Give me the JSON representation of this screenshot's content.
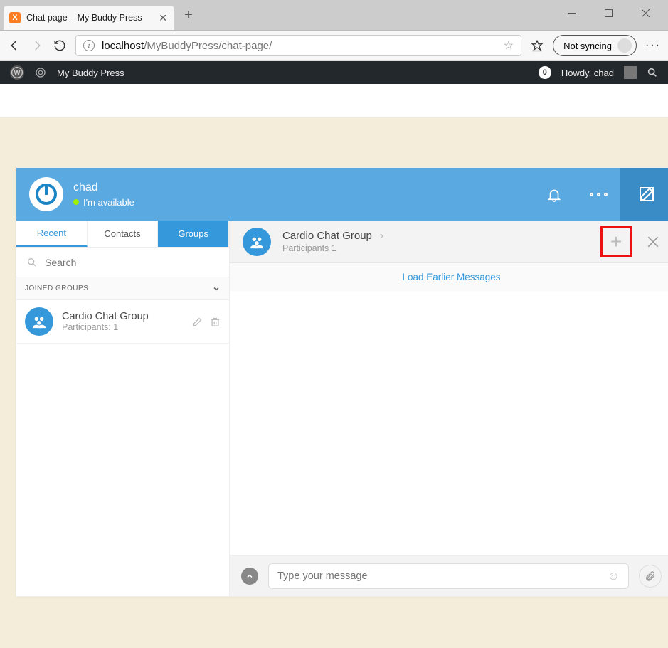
{
  "browser": {
    "tab_title": "Chat page – My Buddy Press",
    "url_host": "localhost",
    "url_path": "/MyBuddyPress/chat-page/",
    "not_syncing": "Not syncing"
  },
  "wpbar": {
    "site_name": "My Buddy Press",
    "badge_count": "0",
    "greeting": "Howdy, chad"
  },
  "messenger": {
    "user_name": "chad",
    "user_status": "I'm available",
    "tabs": {
      "recent": "Recent",
      "contacts": "Contacts",
      "groups": "Groups"
    },
    "search_placeholder": "Search",
    "section_header": "JOINED GROUPS",
    "group": {
      "name": "Cardio Chat Group",
      "participants_label": "Participants: 1"
    },
    "conversation": {
      "title": "Cardio Chat Group",
      "participants": "Participants 1",
      "load_earlier": "Load Earlier Messages"
    },
    "compose_placeholder": "Type your message"
  }
}
